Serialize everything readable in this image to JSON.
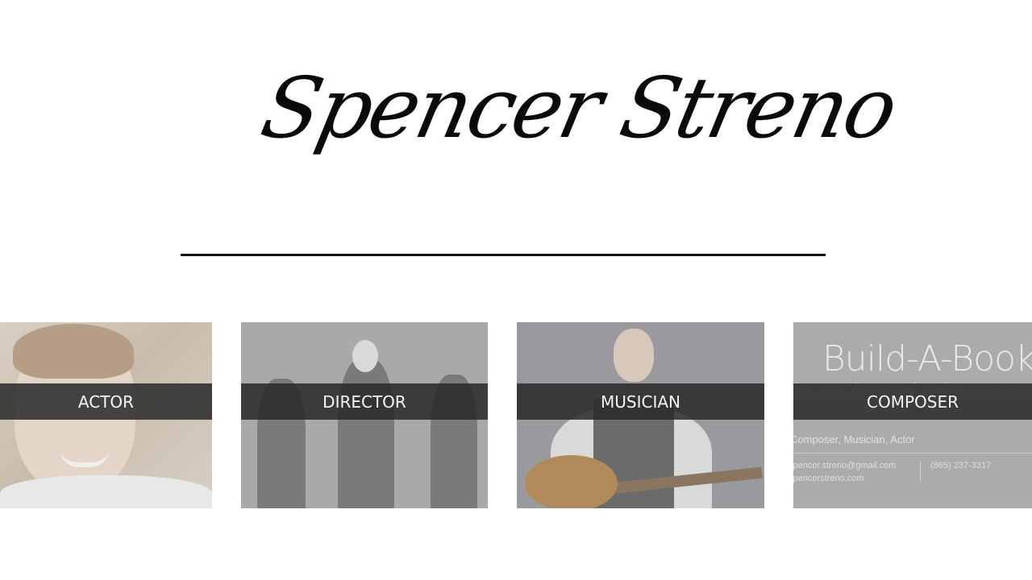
{
  "header": {
    "title": "Spencer Streno"
  },
  "tiles": [
    {
      "label": "ACTOR"
    },
    {
      "label": "DIRECTOR"
    },
    {
      "label": "MUSICIAN"
    },
    {
      "label": "COMPOSER"
    }
  ],
  "composer_card": {
    "brand": "Build-A-Book",
    "tagline": "Put your heart and soul in your repertoire",
    "roles": "Composer, Musician, Actor",
    "email": "spencer.streno@gmail.com",
    "website": "spencerstreno.com",
    "phone": "(865) 237-3317"
  },
  "colors": {
    "background": "#ffffff",
    "label_band": "#282828",
    "label_text": "#f5f5f5",
    "title": "#0a0a0a"
  }
}
